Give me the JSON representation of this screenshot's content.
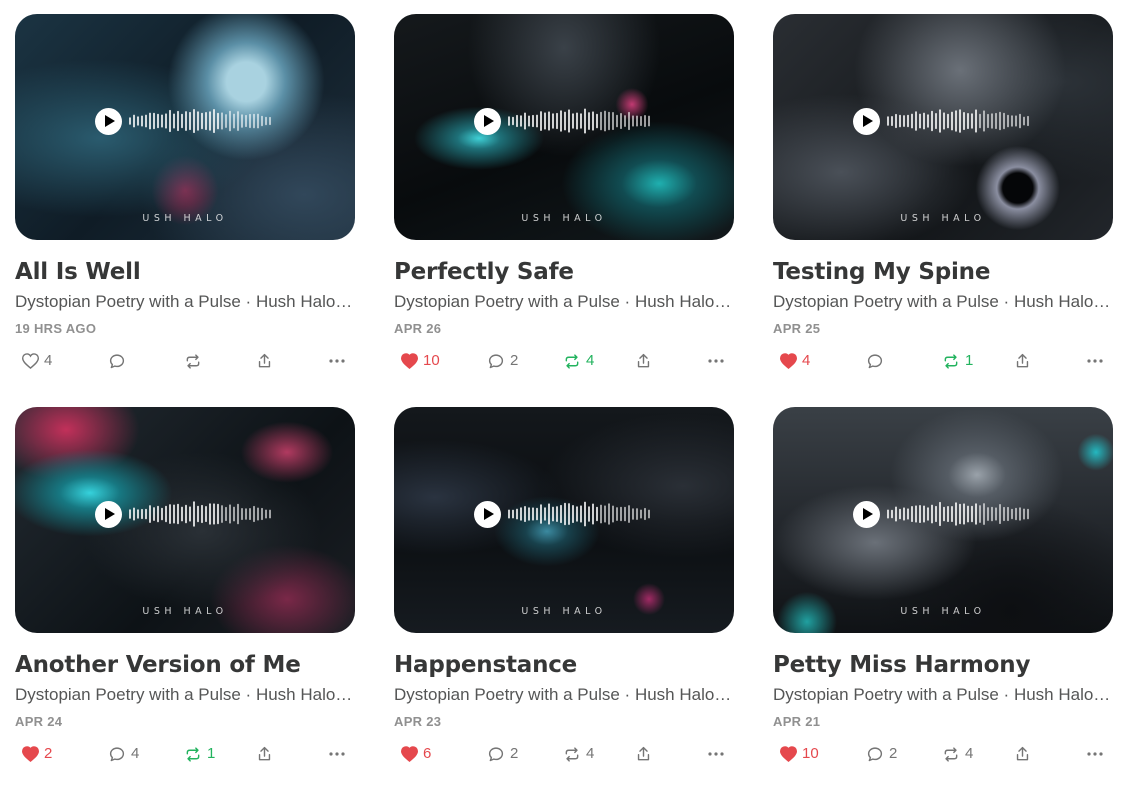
{
  "colors": {
    "like": "#e5484d",
    "restack": "#22b35e",
    "muted": "#757575"
  },
  "icons": [
    "play-icon",
    "heart-icon",
    "comment-icon",
    "restack-icon",
    "share-icon",
    "more-icon"
  ],
  "posts": [
    {
      "title": "All Is Well",
      "subtitle": "Dystopian Poetry with a Pulse · Hush Halo…",
      "date": "19 HRS AGO",
      "watermark": "USH HALO",
      "likes": "4",
      "liked": false,
      "comments": "",
      "restacks": "",
      "restacked": false
    },
    {
      "title": "Perfectly Safe",
      "subtitle": "Dystopian Poetry with a Pulse · Hush Halo…",
      "date": "APR 26",
      "watermark": "USH HALO",
      "likes": "10",
      "liked": true,
      "comments": "2",
      "restacks": "4",
      "restacked": true
    },
    {
      "title": "Testing My Spine",
      "subtitle": "Dystopian Poetry with a Pulse · Hush Halo…",
      "date": "APR 25",
      "watermark": "USH HALO",
      "likes": "4",
      "liked": true,
      "comments": "",
      "restacks": "1",
      "restacked": true
    },
    {
      "title": "Another Version of Me",
      "subtitle": "Dystopian Poetry with a Pulse · Hush Halo…",
      "date": "APR 24",
      "watermark": "USH HALO",
      "likes": "2",
      "liked": true,
      "comments": "4",
      "restacks": "1",
      "restacked": true
    },
    {
      "title": "Happenstance",
      "subtitle": "Dystopian Poetry with a Pulse · Hush Halo…",
      "date": "APR 23",
      "watermark": "USH HALO",
      "likes": "6",
      "liked": true,
      "comments": "2",
      "restacks": "4",
      "restacked": false
    },
    {
      "title": "Petty Miss Harmony",
      "subtitle": "Dystopian Poetry with a Pulse · Hush Halo…",
      "date": "APR 21",
      "watermark": "USH HALO",
      "likes": "10",
      "liked": true,
      "comments": "2",
      "restacks": "4",
      "restacked": false
    }
  ]
}
